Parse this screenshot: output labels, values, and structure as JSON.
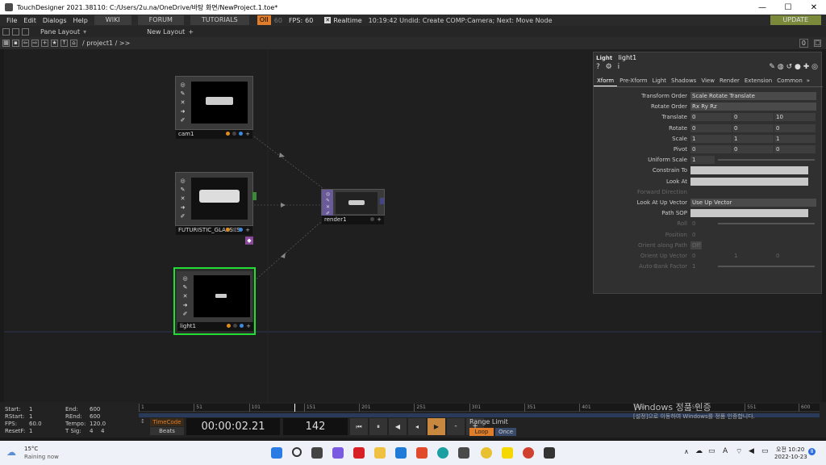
{
  "window": {
    "title": "TouchDesigner 2021.38110: C:/Users/2u.na/OneDrive/바탕 화면/NewProject.1.toe*"
  },
  "menu": {
    "items": [
      "File",
      "Edit",
      "Dialogs",
      "Help"
    ],
    "wiki": "WIKI",
    "forum": "FORUM",
    "tutorials": "TUTORIALS",
    "perf": "OII",
    "perf_val": "60",
    "fps_label": "FPS:",
    "fps_val": "60",
    "realtime": "Realtime",
    "status": "10:19:42 Undid: Create COMP:Camera; Next: Move Node",
    "update": "UPDATE"
  },
  "layout": {
    "pane_layout": "Pane Layout",
    "new_layout": "New Layout"
  },
  "path": {
    "text": "/ project1 / >>",
    "pane_num": "0"
  },
  "nodes": {
    "cam": {
      "label": "cam1"
    },
    "geo": {
      "label": "FUTURISTIC_GLASSES"
    },
    "light": {
      "label": "light1"
    },
    "render": {
      "label": "render1"
    }
  },
  "params": {
    "op_type": "Light",
    "op_name": "light1",
    "tabs": [
      "Xform",
      "Pre-Xform",
      "Light",
      "Shadows",
      "View",
      "Render",
      "Extension",
      "Common"
    ],
    "rows": [
      {
        "name": "Transform Order",
        "type": "menu",
        "value": "Scale Rotate Translate"
      },
      {
        "name": "Rotate Order",
        "type": "menu",
        "value": "Rx Ry Rz"
      },
      {
        "name": "Translate",
        "type": "xyz",
        "values": [
          "0",
          "0",
          "10"
        ]
      },
      {
        "name": "Rotate",
        "type": "xyz",
        "values": [
          "0",
          "0",
          "0"
        ]
      },
      {
        "name": "Scale",
        "type": "xyz",
        "values": [
          "1",
          "1",
          "1"
        ]
      },
      {
        "name": "Pivot",
        "type": "xyz",
        "values": [
          "0",
          "0",
          "0"
        ]
      },
      {
        "name": "Uniform Scale",
        "type": "slider",
        "value": "1"
      },
      {
        "name": "Constrain To",
        "type": "text",
        "value": ""
      },
      {
        "name": "Look At",
        "type": "text",
        "value": ""
      },
      {
        "name": "Forward Direction",
        "type": "dim",
        "value": ""
      },
      {
        "name": "Look At Up Vector",
        "type": "menu",
        "value": "Use Up Vector"
      },
      {
        "name": "Path SOP",
        "type": "text",
        "value": ""
      },
      {
        "name": "Roll",
        "type": "dimslider",
        "value": "0"
      },
      {
        "name": "Position",
        "type": "dim",
        "value": "0"
      },
      {
        "name": "Orient along Path",
        "type": "dimtoggle",
        "value": "Off"
      },
      {
        "name": "Orient Up Vector",
        "type": "dimxyz",
        "values": [
          "0",
          "1",
          "0"
        ]
      },
      {
        "name": "Auto-Bank Factor",
        "type": "dimslider",
        "value": "1"
      }
    ]
  },
  "timeline": {
    "start_label": "Start:",
    "start": "1",
    "rstart_label": "RStart:",
    "rstart": "1",
    "fps_label": "FPS:",
    "fps": "60.0",
    "resetf_label": "ResetF:",
    "resetf": "1",
    "end_label": "End:",
    "end": "600",
    "rend_label": "REnd:",
    "rend": "600",
    "tempo_label": "Tempo:",
    "tempo": "120.0",
    "tsig_label": "T Sig:",
    "tsig1": "4",
    "tsig2": "4",
    "ruler": [
      "1",
      "51",
      "101",
      "151",
      "201",
      "251",
      "301",
      "351",
      "401",
      "451",
      "501",
      "551",
      "600"
    ],
    "timecode_tab": "TimeCode",
    "beats_tab": "Beats",
    "timecode": "00:00:02.21",
    "frame": "142",
    "range_label": "Range Limit",
    "loop": "Loop",
    "once": "Once"
  },
  "watermark": {
    "line1": "Windows 정품 인증",
    "line2": "[설정]으로 이동하여 Windows를 정품 인증합니다."
  },
  "taskbar": {
    "temp": "15°C",
    "weather": "Raining now",
    "time": "오전 10:20",
    "date": "2022-10-23",
    "lang": "A",
    "notif": "8"
  },
  "colors": {
    "accent_orange": "#e07d2a",
    "selected_green": "#22dd33",
    "render_purple": "#6a5a9a",
    "update_green": "#7a8a3a"
  }
}
